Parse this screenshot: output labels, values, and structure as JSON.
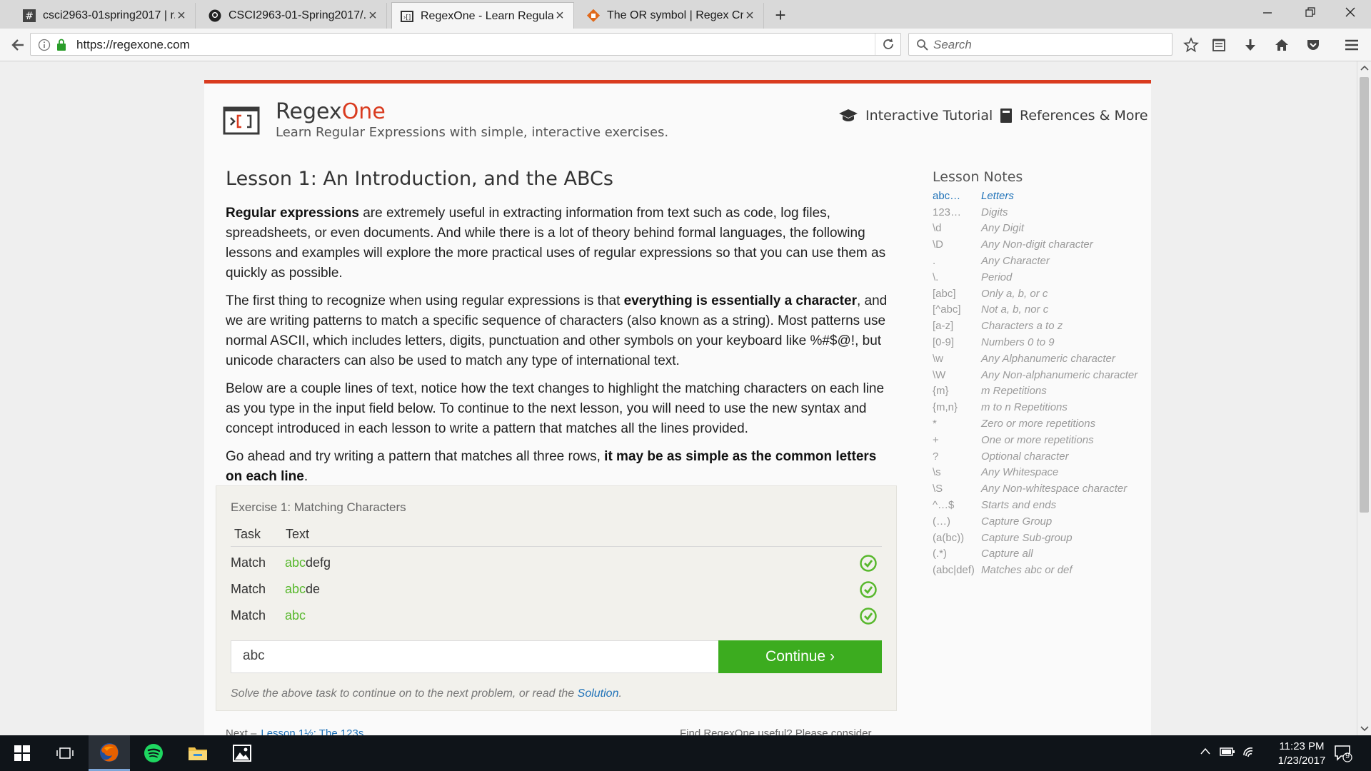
{
  "browser": {
    "tabs": [
      {
        "title": "csci2963-01spring2017 | r...",
        "favicon": "hash-icon",
        "active": false
      },
      {
        "title": "CSCI2963-01-Spring2017/...",
        "favicon": "github-icon",
        "active": false
      },
      {
        "title": "RegexOne - Learn Regular...",
        "favicon": "regexone-icon",
        "active": true
      },
      {
        "title": "The OR symbol | Regex Cr...",
        "favicon": "regexcrossword-icon",
        "active": false
      }
    ],
    "url": "https://regexone.com",
    "search_placeholder": "Search"
  },
  "site": {
    "brand_regex": "Regex",
    "brand_one": "One",
    "tagline": "Learn Regular Expressions with simple, interactive exercises.",
    "nav_tutorial": "Interactive Tutorial",
    "nav_references": "References & More",
    "accent_color": "#d93b1f"
  },
  "lesson": {
    "title": "Lesson 1: An Introduction, and the ABCs",
    "p1_bold": "Regular expressions",
    "p1_rest": " are extremely useful in extracting information from text such as code, log files, spreadsheets, or even documents. And while there is a lot of theory behind formal languages, the following lessons and examples will explore the more practical uses of regular expressions so that you can use them as quickly as possible.",
    "p2_start": "The first thing to recognize when using regular expressions is that ",
    "p2_bold": "everything is essentially a character",
    "p2_rest": ", and we are writing patterns to match a specific sequence of characters (also known as a string). Most patterns use normal ASCII, which includes letters, digits, punctuation and other symbols on your keyboard like %#$@!, but unicode characters can also be used to match any type of international text.",
    "p3": "Below are a couple lines of text, notice how the text changes to highlight the matching characters on each line as you type in the input field below. To continue to the next lesson, you will need to use the new syntax and concept introduced in each lesson to write a pattern that matches all the lines provided.",
    "p4_start": "Go ahead and try writing a pattern that matches all three rows, ",
    "p4_bold": "it may be as simple as the common letters on each line",
    "p4_end": "."
  },
  "exercise": {
    "title": "Exercise 1: Matching Characters",
    "col_task": "Task",
    "col_text": "Text",
    "rows": [
      {
        "task": "Match",
        "matched": "abc",
        "rest": "defg",
        "status": "check-icon"
      },
      {
        "task": "Match",
        "matched": "abc",
        "rest": "de",
        "status": "check-icon"
      },
      {
        "task": "Match",
        "matched": "abc",
        "rest": "",
        "status": "check-icon"
      }
    ],
    "input_value": "abc",
    "continue_label": "Continue ›",
    "note_text": "Solve the above task to continue on to the next problem, or read the ",
    "note_link": "Solution",
    "note_end": ".",
    "success_color": "#58b82d"
  },
  "footer": {
    "next_label": "Next –",
    "next_link": "Lesson 1½: The 123s",
    "support_text": "Find RegexOne useful? Please consider"
  },
  "notes": {
    "title": "Lesson Notes",
    "items": [
      {
        "pattern": "abc…",
        "desc": "Letters",
        "active": true
      },
      {
        "pattern": "123…",
        "desc": "Digits"
      },
      {
        "pattern": "\\d",
        "desc": "Any Digit"
      },
      {
        "pattern": "\\D",
        "desc": "Any Non-digit character"
      },
      {
        "pattern": ".",
        "desc": "Any Character"
      },
      {
        "pattern": "\\.",
        "desc": "Period"
      },
      {
        "pattern": "[abc]",
        "desc": "Only a, b, or c"
      },
      {
        "pattern": "[^abc]",
        "desc": "Not a, b, nor c"
      },
      {
        "pattern": "[a-z]",
        "desc": "Characters a to z"
      },
      {
        "pattern": "[0-9]",
        "desc": "Numbers 0 to 9"
      },
      {
        "pattern": "\\w",
        "desc": "Any Alphanumeric character"
      },
      {
        "pattern": "\\W",
        "desc": "Any Non-alphanumeric character"
      },
      {
        "pattern": "{m}",
        "desc": "m Repetitions"
      },
      {
        "pattern": "{m,n}",
        "desc": "m to n Repetitions"
      },
      {
        "pattern": "*",
        "desc": "Zero or more repetitions"
      },
      {
        "pattern": "+",
        "desc": "One or more repetitions"
      },
      {
        "pattern": "?",
        "desc": "Optional character"
      },
      {
        "pattern": "\\s",
        "desc": "Any Whitespace"
      },
      {
        "pattern": "\\S",
        "desc": "Any Non-whitespace character"
      },
      {
        "pattern": "^…$",
        "desc": "Starts and ends"
      },
      {
        "pattern": "(…)",
        "desc": "Capture Group"
      },
      {
        "pattern": "(a(bc))",
        "desc": "Capture Sub-group"
      },
      {
        "pattern": "(.*)",
        "desc": "Capture all"
      },
      {
        "pattern": "(abc|def)",
        "desc": "Matches abc or def"
      }
    ]
  },
  "taskbar": {
    "time": "11:23 PM",
    "date": "1/23/2017",
    "notification_count": "9"
  }
}
